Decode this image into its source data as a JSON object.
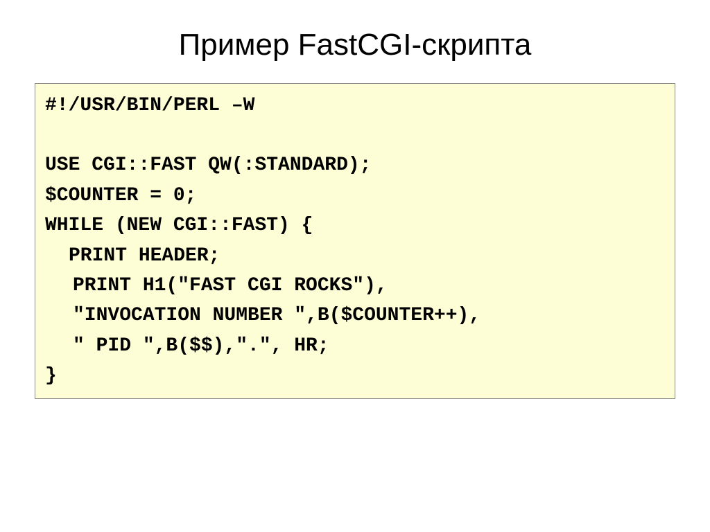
{
  "title": "Пример FastCGI-скрипта",
  "code": {
    "line1": "#!/usr/bin/perl –w",
    "line2": "use CGI::Fast qw(:standard);",
    "line3": "$counter = 0;",
    "line4": "while (new CGI::Fast) {",
    "line5": "print header;",
    "line6": "print h1(\"Fast CGI Rocks\"),",
    "line7": "\"Invocation number \",b($counter++),",
    "line8": "\" PID \",b($$),\".\", hr;",
    "line9": "}"
  }
}
